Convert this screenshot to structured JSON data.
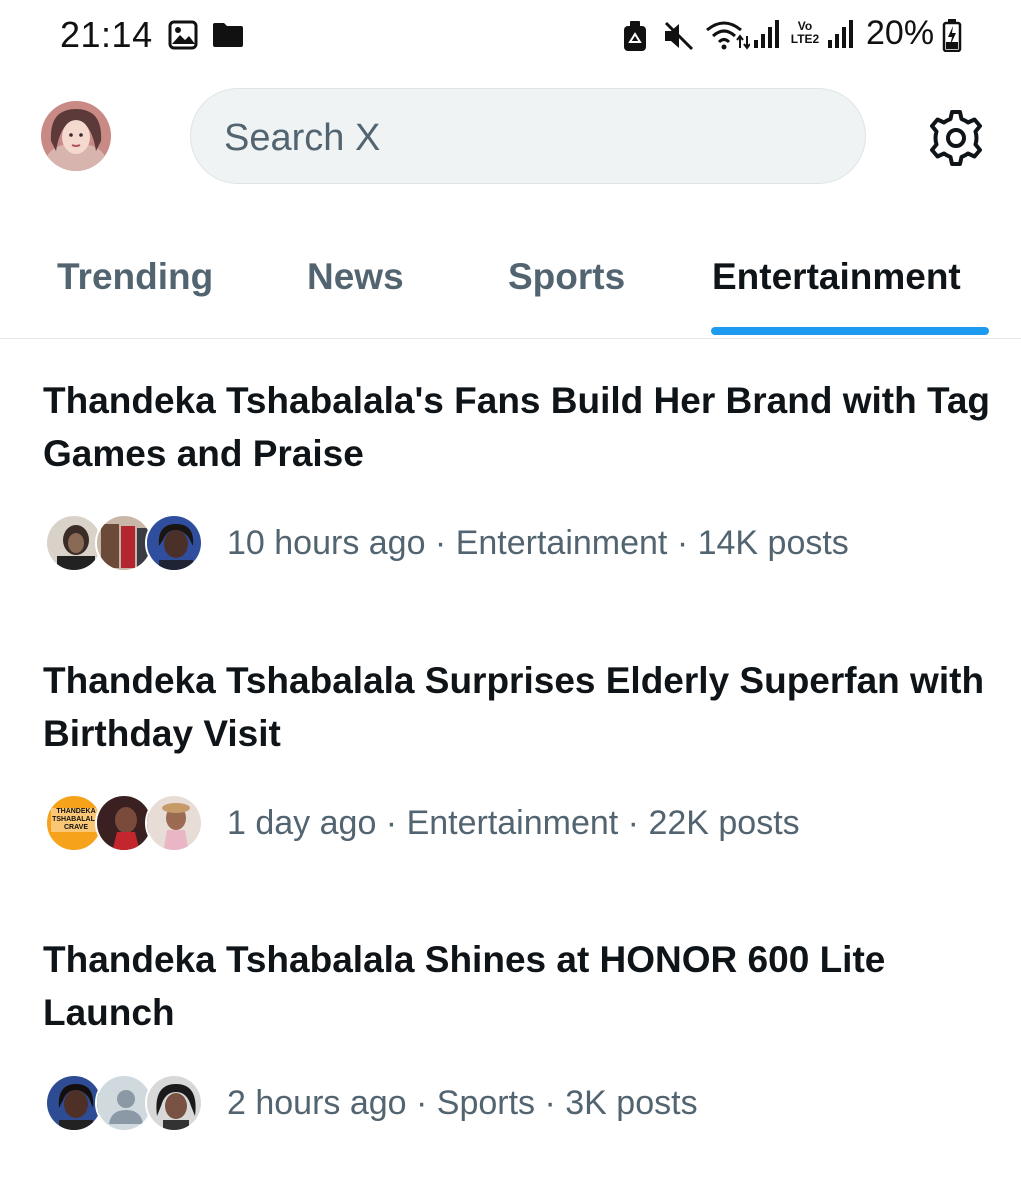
{
  "status_bar": {
    "time": "21:14",
    "battery": "20%",
    "network_label": "Vo LTE2",
    "icons": [
      "gallery-icon",
      "folder-icon",
      "recycle-icon",
      "mute-icon",
      "wifi-icon",
      "signal-icon",
      "battery-charging-icon"
    ]
  },
  "header": {
    "search_placeholder": "Search X",
    "settings_icon": "gear-icon"
  },
  "tabs": [
    {
      "label": "Trending",
      "active": false
    },
    {
      "label": "News",
      "active": false
    },
    {
      "label": "Sports",
      "active": false
    },
    {
      "label": "Entertainment",
      "active": true
    }
  ],
  "trends": [
    {
      "title": "Thandeka Tshabalala's Fans Build Her Brand with Tag Games and Praise",
      "meta": "10 hours ago · Entertainment · 14K posts"
    },
    {
      "title": "Thandeka Tshabalala Surprises Elderly Superfan with Birthday Visit",
      "meta": "1 day ago · Entertainment · 22K posts",
      "badge_text": "THANDEKA TSHABALALA CRAVE"
    },
    {
      "title": "Thandeka Tshabalala Shines at HONOR 600 Lite Launch",
      "meta": "2 hours ago · Sports · 3K posts"
    }
  ],
  "colors": {
    "accent": "#1d9bf0",
    "text_primary": "#0f1419",
    "text_secondary": "#536471",
    "search_bg": "#eff3f4"
  }
}
